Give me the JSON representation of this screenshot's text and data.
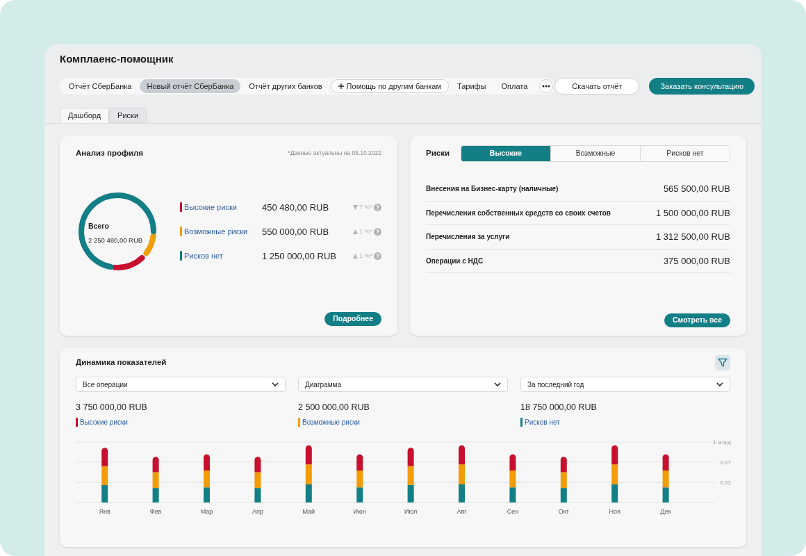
{
  "window": {
    "title": "Комплаенс-помощник"
  },
  "nav": [
    {
      "label": "Отчёт СберБанка",
      "selected": false,
      "kind": "link"
    },
    {
      "label": "Новый отчёт СберБанка",
      "selected": true,
      "kind": "link"
    },
    {
      "label": "Отчёт других банков",
      "selected": false,
      "kind": "link"
    },
    {
      "label": "Помощь по другим банкам",
      "selected": false,
      "kind": "add"
    },
    {
      "label": "Тарифы",
      "selected": false,
      "kind": "link"
    },
    {
      "label": "Оплата",
      "selected": false,
      "kind": "link"
    }
  ],
  "actions": [
    {
      "label": "Скачать отчёт",
      "kind": "secondary"
    },
    {
      "label": "Заказать консультацию",
      "kind": "primary"
    }
  ],
  "tabs": [
    {
      "label": "Дашборд",
      "selected": true
    },
    {
      "label": "Риски",
      "selected": false
    }
  ],
  "profile": {
    "title": "Анализ профиля",
    "note": "*Данные актуальны на 05.10.2022",
    "total_label": "Всего",
    "total": "2 250 480,00 RUB",
    "items": [
      {
        "label": "Высокие риски",
        "color": "#c8102e",
        "amount": "450 480,00 RUB",
        "delta": "7 %*",
        "kind": "down"
      },
      {
        "label": "Возможные риски",
        "color": "#f29c07",
        "amount": "550 000,00 RUB",
        "delta": "1 %*",
        "kind": "up"
      },
      {
        "label": "Рисков нет",
        "color": "#127e86",
        "amount": "1 250 000,00 RUB",
        "delta": "1 %*",
        "kind": "up"
      }
    ],
    "button": "Подробнее"
  },
  "risks": {
    "title": "Риски",
    "tabs": [
      {
        "label": "Высокие",
        "selected": true
      },
      {
        "label": "Возможные",
        "selected": false
      },
      {
        "label": "Рисков нет",
        "selected": false
      }
    ],
    "rows": [
      {
        "name": "Внесения на Бизнес-карту (наличные)",
        "amount": "565 500,00 RUB"
      },
      {
        "name": "Перечисления собственных средств со своих счетов",
        "amount": "1 500 000,00 RUB"
      },
      {
        "name": "Перечисления за услуги",
        "amount": "1 312 500,00 RUB"
      },
      {
        "name": "Операции с НДС",
        "amount": "375 000,00 RUB"
      }
    ],
    "button": "Смотреть все"
  },
  "dynamics": {
    "title": "Динамика показателей",
    "selects": [
      {
        "value": "Все операции"
      },
      {
        "value": "Диаграмма"
      },
      {
        "value": "За последний год"
      }
    ],
    "totals": [
      {
        "amount": "3 750 000,00 RUB",
        "label": "Высокие риски",
        "color": "#c8102e"
      },
      {
        "amount": "2 500 000,00 RUB",
        "label": "Возможные риски",
        "color": "#f29c07"
      },
      {
        "amount": "18 750 000,00 RUB",
        "label": "Рисков нет",
        "color": "#127e86"
      }
    ],
    "chart_data": {
      "type": "bar",
      "stacked": true,
      "categories": [
        "Янв",
        "Фев",
        "Мар",
        "Апр",
        "Май",
        "Июн",
        "Июл",
        "Авг",
        "Сен",
        "Окт",
        "Ноя",
        "Дек"
      ],
      "ylim": [
        0,
        1
      ],
      "yticks": [
        {
          "value": 0.33,
          "label": "0,33"
        },
        {
          "value": 0.67,
          "label": "0,67"
        },
        {
          "value": 1,
          "label": "1 млрд"
        }
      ],
      "series": [
        {
          "color": "#127e86",
          "values": [
            0.29,
            0.24,
            0.25,
            0.24,
            0.3,
            0.25,
            0.29,
            0.3,
            0.25,
            0.24,
            0.3,
            0.25
          ]
        },
        {
          "color": "#f29c07",
          "values": [
            0.31,
            0.26,
            0.28,
            0.26,
            0.33,
            0.28,
            0.31,
            0.33,
            0.28,
            0.26,
            0.33,
            0.28
          ]
        },
        {
          "color": "#c8102e",
          "values": [
            0.3,
            0.25,
            0.26,
            0.25,
            0.31,
            0.26,
            0.3,
            0.31,
            0.26,
            0.25,
            0.31,
            0.26
          ]
        }
      ]
    }
  }
}
